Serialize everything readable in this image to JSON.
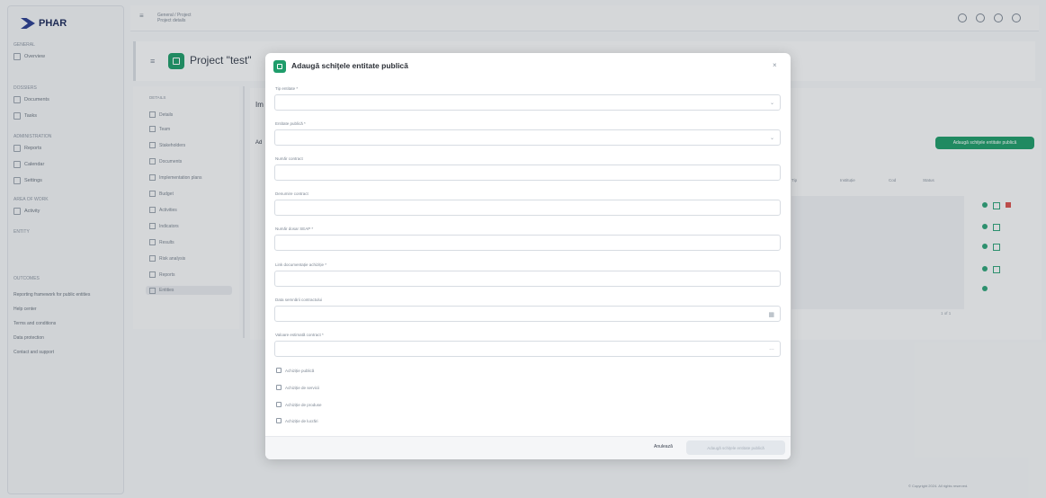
{
  "app": {
    "logo_text": "PHAR",
    "sidebar": {
      "sections": [
        "GENERAL",
        "DOSSIERS",
        "ADMINISTRATION",
        "AREA OF WORK",
        "ENTITY",
        "OUTCOMES"
      ],
      "items": [
        "Overview",
        "Documents",
        "Tasks",
        "Reports",
        "Calendar",
        "Settings",
        "Activity"
      ],
      "links": [
        "Reporting framework for public entities",
        "Help center",
        "Terms and conditions",
        "Data protection",
        "Contact and support"
      ]
    },
    "topbar": {
      "breadcrumb_line1": "General / Project",
      "breadcrumb_line2": "Project details"
    },
    "project": {
      "title": "Project \"test\""
    },
    "subnav": {
      "header": "DETAILS",
      "items": [
        "Details",
        "Team",
        "Stakeholders",
        "Documents",
        "Implementation plans",
        "Budget",
        "Activities",
        "Indicators",
        "Results",
        "Risk analysis",
        "Reports",
        "Entities"
      ]
    },
    "content": {
      "section_title": "Im",
      "sub_title": "Ad",
      "add_button": "Adaugă schiţele entitate publică",
      "table_headers": [
        "Tip",
        "Instituție",
        "Cod",
        "Status"
      ],
      "pager": "1 of 1"
    },
    "footer_note": "© Copyright 2024. All rights reserved."
  },
  "modal": {
    "title": "Adaugă schiţele entitate publică",
    "close_label": "×",
    "fields": [
      {
        "label": "Tip entitate *",
        "type": "select"
      },
      {
        "label": "Entitate publică *",
        "type": "select"
      },
      {
        "label": "Număr contract",
        "type": "text"
      },
      {
        "label": "Denumire contract",
        "type": "text"
      },
      {
        "label": "Număr dosar SEAP *",
        "type": "text"
      },
      {
        "label": "Link documentație achiziție *",
        "type": "text"
      },
      {
        "label": "Data semnării contractului",
        "type": "date"
      },
      {
        "label": "Valoare estimată contract *",
        "type": "select"
      }
    ],
    "checkboxes": [
      "Achiziție publică",
      "Achiziție de servicii",
      "Achiziție de produse",
      "Achiziție de lucrări"
    ],
    "cancel_label": "Anulează",
    "submit_label": "Adaugă schiţele entitate publică"
  }
}
